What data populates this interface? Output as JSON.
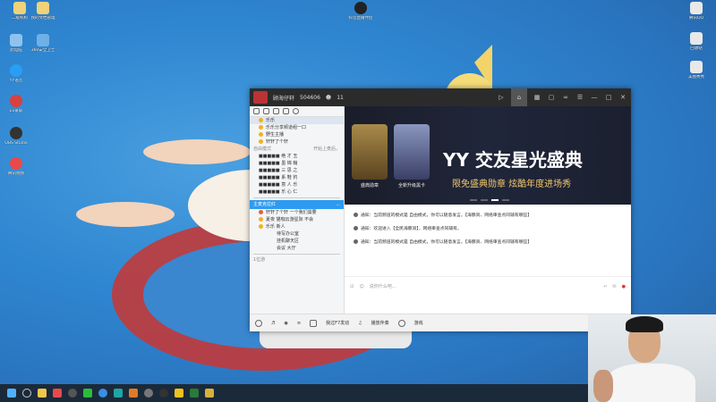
{
  "desktop": {
    "left_icons": [
      {
        "label": "二级机构",
        "color": "#f0d27a"
      },
      {
        "label": "我的文档管理",
        "color": "#f0d27a"
      },
      {
        "label": "此电脑",
        "color": "#8fc3ee"
      },
      {
        "label": "360安全卫士",
        "color": "#6fb0e8"
      },
      {
        "label": "YY语音",
        "color": "#2a9df4"
      },
      {
        "label": "Ev录屏",
        "color": "#d94040"
      },
      {
        "label": "OBS Studio",
        "color": "#333333"
      },
      {
        "label": "腾讯视频",
        "color": "#e84a4a"
      }
    ],
    "right_icons": [
      {
        "label": "腾讯QQ",
        "color": "#e8e8e8"
      },
      {
        "label": "回收站",
        "color": "#e8e8e8"
      },
      {
        "label": "美图秀秀",
        "color": "#e8e8e8"
      },
      {
        "label": "酷狗音乐",
        "color": "#e8e8e8"
      }
    ],
    "top_icon": {
      "label": "抖音直播伴侣"
    }
  },
  "window": {
    "title": "顾海仔轩",
    "channel_id": "504606",
    "online_count": "11",
    "left_panel": {
      "rows": [
        {
          "label": "乐乐",
          "selected": true
        },
        {
          "label": "乐乐分享频道组一口",
          "selected": false
        },
        {
          "label": "野生主播",
          "selected": false
        },
        {
          "label": "轩轩了个轩",
          "selected": false
        }
      ],
      "section_label": "自由模式",
      "section_right": "开始上麦后，",
      "members": [
        {
          "label": "■■■■■ 绝 才 玉"
        },
        {
          "label": "■■■■■ 墨 锦 翰"
        },
        {
          "label": "■■■■■ 三 思 之"
        },
        {
          "label": "■■■■■ 系 鞋 钓"
        },
        {
          "label": "■■■■■ 意 人 乐"
        },
        {
          "label": "■■■■■ 乐 心 仁"
        }
      ],
      "bar_label": "主麦克拉红",
      "bar_right": "...",
      "sub_rows": [
        {
          "label": "轩轩了个轩 一个我们需要"
        },
        {
          "label": "夏夜 猫咖云游星际 不会"
        },
        {
          "label": "乐乐 新人"
        }
      ],
      "rooms": [
        {
          "label": "待写办公室"
        },
        {
          "label": "挂机聊天区"
        },
        {
          "label": "会议 大厅"
        }
      ],
      "footer_label": "1位游"
    },
    "banner": {
      "medal1_label": "盛典勋章",
      "medal2_label": "全新升级黑卡",
      "title": "YY 交友星光盛典",
      "subtitle": "限免盛典勋章  炫酷年度进场秀"
    },
    "chat": [
      {
        "text": "通知：当前频道的模式是 自由模式，你可以随意发言。【海豚资、网络审查点同辅有哪些】"
      },
      {
        "text": "通知：欢迎进入【全民海豚资】，网络审查点同辅有。"
      },
      {
        "text": "通知：当前频道的模式是 自由模式，你可以随意发言。【海豚资、网络审查点同辅有哪些】"
      }
    ],
    "input_placeholder": "说你什么吧...",
    "bottom_bar": {
      "item1": "我过F7发动",
      "item2": "播放伴奏",
      "item3": "游戏"
    }
  }
}
